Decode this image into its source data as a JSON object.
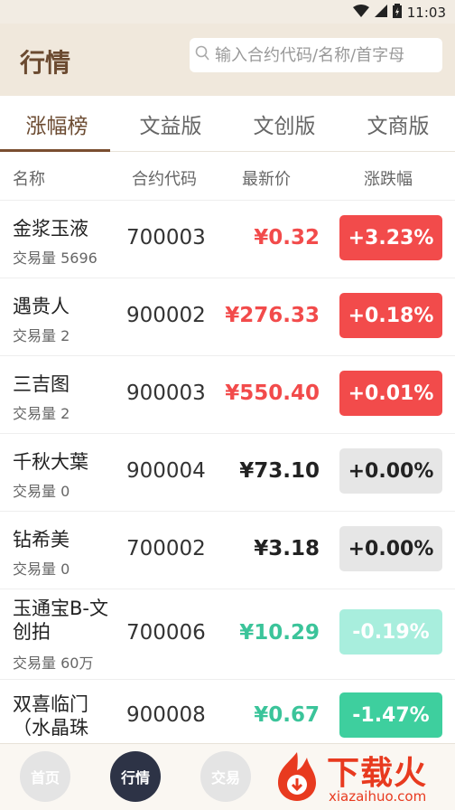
{
  "status_bar": {
    "time": "11:03"
  },
  "header": {
    "title": "行情",
    "search_placeholder": "输入合约代码/名称/首字母"
  },
  "tabs": [
    {
      "label": "涨幅榜",
      "active": true
    },
    {
      "label": "文益版",
      "active": false
    },
    {
      "label": "文创版",
      "active": false
    },
    {
      "label": "文商版",
      "active": false
    }
  ],
  "columns": {
    "name": "名称",
    "code": "合约代码",
    "price": "最新价",
    "change": "涨跌幅"
  },
  "rows": [
    {
      "name": "金浆玉液",
      "volume": "交易量 5696",
      "code": "700003",
      "price": "¥0.32",
      "change": "+3.23%",
      "trend": "up"
    },
    {
      "name": "遇贵人",
      "volume": "交易量 2",
      "code": "900002",
      "price": "¥276.33",
      "change": "+0.18%",
      "trend": "up"
    },
    {
      "name": "三吉图",
      "volume": "交易量 2",
      "code": "900003",
      "price": "¥550.40",
      "change": "+0.01%",
      "trend": "up"
    },
    {
      "name": "千秋大葉",
      "volume": "交易量 0",
      "code": "900004",
      "price": "¥73.10",
      "change": "+0.00%",
      "trend": "flat"
    },
    {
      "name": "钻希美",
      "volume": "交易量 0",
      "code": "700002",
      "price": "¥3.18",
      "change": "+0.00%",
      "trend": "flat"
    },
    {
      "name": "玉通宝B-文创拍",
      "volume": "交易量 60万",
      "code": "700006",
      "price": "¥10.29",
      "change": "-0.19%",
      "trend": "down-light"
    },
    {
      "name": "双喜临门（水晶珠",
      "volume": "",
      "code": "900008",
      "price": "¥0.67",
      "change": "-1.47%",
      "trend": "down"
    }
  ],
  "bottom_nav": [
    {
      "label": "首页",
      "active": false
    },
    {
      "label": "行情",
      "active": true
    },
    {
      "label": "交易",
      "active": false
    }
  ],
  "watermark": {
    "brand": "下载火",
    "url": "xiazaihuo.com"
  },
  "colors": {
    "up": "#f24b4b",
    "up_bg": "#f24b4b",
    "flat_bg": "#e6e6e6",
    "down_light_bg": "#a8eedd",
    "down_bg": "#3ecf9e",
    "down_text": "#3bc49a",
    "brand_brown": "#6b4a30"
  }
}
